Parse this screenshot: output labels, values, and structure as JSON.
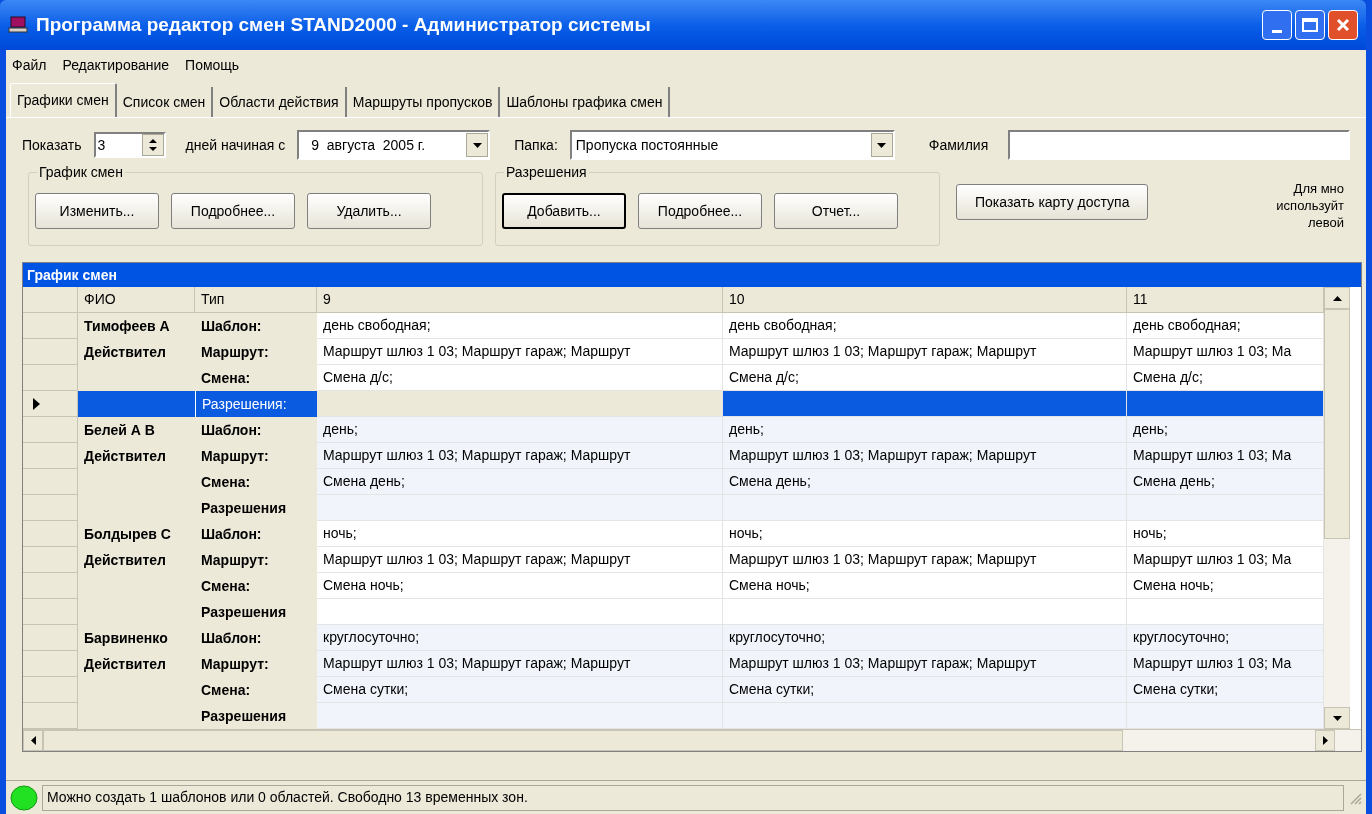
{
  "window": {
    "title": "Программа редактор смен STAND2000 - Администратор системы"
  },
  "menu": [
    "Файл",
    "Редактирование",
    "Помощь"
  ],
  "tabs": [
    {
      "label": "Графики смен",
      "selected": true
    },
    {
      "label": "Список смен",
      "selected": false
    },
    {
      "label": "Области действия",
      "selected": false
    },
    {
      "label": "Маршруты пропусков",
      "selected": false
    },
    {
      "label": "Шаблоны графика смен",
      "selected": false
    }
  ],
  "filters": {
    "show_label": "Показать",
    "days": "3",
    "days_label": "дней начиная с",
    "date": "9  августа  2005 г.",
    "folder_label": "Папка:",
    "folder": "Пропуска постоянные",
    "surname_label": "Фамилия"
  },
  "schedule_group": {
    "title": "График смен",
    "buttons": [
      {
        "label": "Изменить...",
        "focused": false
      },
      {
        "label": "Подробнее...",
        "focused": false
      },
      {
        "label": "Удалить...",
        "focused": false
      }
    ]
  },
  "permissions_group": {
    "title": "Разрешения",
    "buttons": [
      {
        "label": "Добавить...",
        "focused": true
      },
      {
        "label": "Подробнее...",
        "focused": false
      },
      {
        "label": "Отчет...",
        "focused": false
      }
    ]
  },
  "access_map_button": "Показать карту доступа",
  "hint_lines": [
    "Для мно",
    "используйт",
    "левой"
  ],
  "grid": {
    "title": "График смен",
    "columns": [
      "ФИО",
      "Тип",
      "9",
      "10",
      "11"
    ],
    "people": [
      {
        "fio": [
          "Тимофеев А",
          "Действител"
        ],
        "rows": [
          {
            "type": "Шаблон:",
            "cells": [
              "день свободная;",
              "день свободная;",
              "день свободная;"
            ],
            "selected": false
          },
          {
            "type": "Маршрут:",
            "cells": [
              "Маршрут шлюз 1 03; Маршрут гараж; Маршрут",
              "Маршрут шлюз 1 03; Маршрут гараж; Маршрут",
              "Маршрут шлюз 1 03; Ма"
            ],
            "selected": false
          },
          {
            "type": "Смена:",
            "cells": [
              "Смена д/с;",
              "Смена д/с;",
              "Смена д/с;"
            ],
            "selected": false
          },
          {
            "type": "Разрешения:",
            "cells": [
              "",
              "",
              ""
            ],
            "selected": true
          }
        ]
      },
      {
        "fio": [
          "Белей А В",
          "Действител"
        ],
        "rows": [
          {
            "type": "Шаблон:",
            "cells": [
              "день;",
              "день;",
              "день;"
            ],
            "selected": false
          },
          {
            "type": "Маршрут:",
            "cells": [
              "Маршрут шлюз 1 03; Маршрут гараж; Маршрут",
              "Маршрут шлюз 1 03; Маршрут гараж; Маршрут",
              "Маршрут шлюз 1 03; Ма"
            ],
            "selected": false
          },
          {
            "type": "Смена:",
            "cells": [
              "Смена день;",
              "Смена день;",
              "Смена день;"
            ],
            "selected": false
          },
          {
            "type": "Разрешения",
            "cells": [
              "",
              "",
              ""
            ],
            "selected": false
          }
        ]
      },
      {
        "fio": [
          "Болдырев С",
          "Действител"
        ],
        "rows": [
          {
            "type": "Шаблон:",
            "cells": [
              "ночь;",
              "ночь;",
              "ночь;"
            ],
            "selected": false
          },
          {
            "type": "Маршрут:",
            "cells": [
              "Маршрут шлюз 1 03; Маршрут гараж; Маршрут",
              "Маршрут шлюз 1 03; Маршрут гараж; Маршрут",
              "Маршрут шлюз 1 03; Ма"
            ],
            "selected": false
          },
          {
            "type": "Смена:",
            "cells": [
              "Смена ночь;",
              "Смена ночь;",
              "Смена ночь;"
            ],
            "selected": false
          },
          {
            "type": "Разрешения",
            "cells": [
              "",
              "",
              ""
            ],
            "selected": false
          }
        ]
      },
      {
        "fio": [
          "Барвиненко",
          "Действител"
        ],
        "rows": [
          {
            "type": "Шаблон:",
            "cells": [
              "круглосуточно;",
              "круглосуточно;",
              "круглосуточно;"
            ],
            "selected": false
          },
          {
            "type": "Маршрут:",
            "cells": [
              "Маршрут шлюз 1 03; Маршрут гараж; Маршрут",
              "Маршрут шлюз 1 03; Маршрут гараж; Маршрут",
              "Маршрут шлюз 1 03; Ма"
            ],
            "selected": false
          },
          {
            "type": "Смена:",
            "cells": [
              "Смена сутки;",
              "Смена сутки;",
              "Смена сутки;"
            ],
            "selected": false
          },
          {
            "type": "Разрешения",
            "cells": [
              "",
              "",
              ""
            ],
            "selected": false
          }
        ]
      }
    ]
  },
  "status_bar": {
    "message": "Можно создать 1 шаблонов или 0 областей. Свободно 13 временных зон."
  }
}
